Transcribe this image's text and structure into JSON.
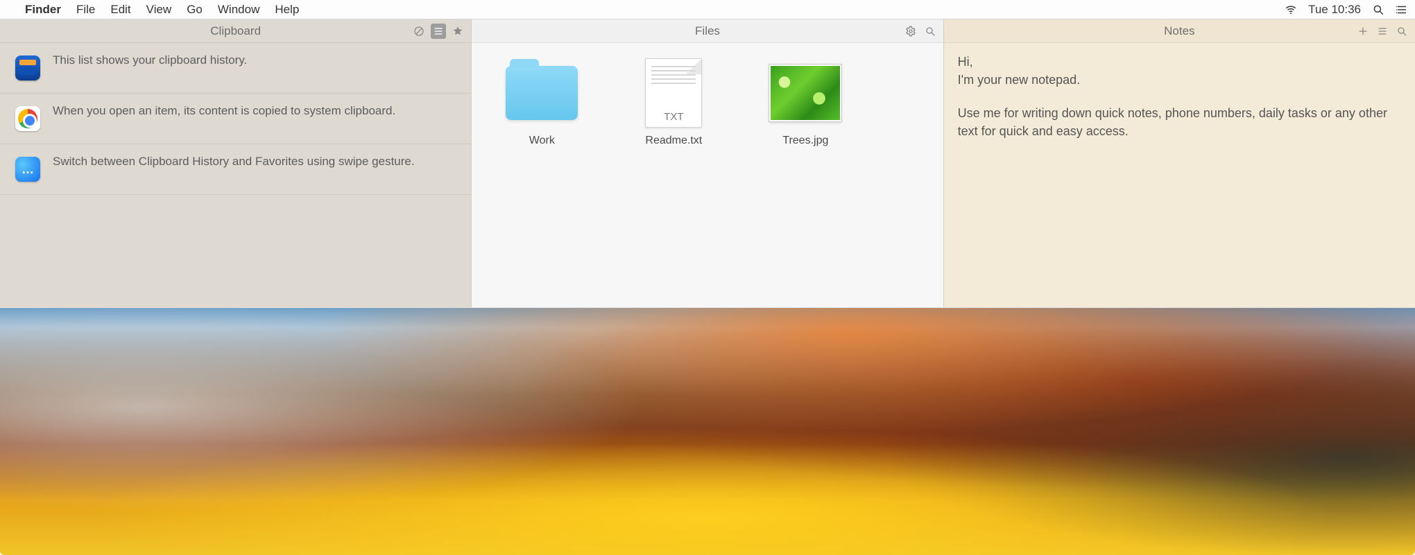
{
  "menubar": {
    "app": "Finder",
    "items": [
      "File",
      "Edit",
      "View",
      "Go",
      "Window",
      "Help"
    ],
    "clock": "Tue 10:36"
  },
  "clipboard": {
    "title": "Clipboard",
    "items": [
      {
        "icon": "wallet",
        "text": "This list shows your clipboard history."
      },
      {
        "icon": "chrome",
        "text": "When you open an item, its content is copied to system clipboard."
      },
      {
        "icon": "messages",
        "text": "Switch between Clipboard History and Favorites using swipe gesture."
      }
    ]
  },
  "files": {
    "title": "Files",
    "items": [
      {
        "kind": "folder",
        "label": "Work"
      },
      {
        "kind": "txt",
        "label": "Readme.txt",
        "ext": "TXT"
      },
      {
        "kind": "image",
        "label": "Trees.jpg"
      }
    ]
  },
  "notes": {
    "title": "Notes",
    "greeting": "Hi,",
    "intro": "I'm your new notepad.",
    "body": "Use me for writing down quick notes, phone numbers, daily tasks or any other text for quick and easy access."
  }
}
